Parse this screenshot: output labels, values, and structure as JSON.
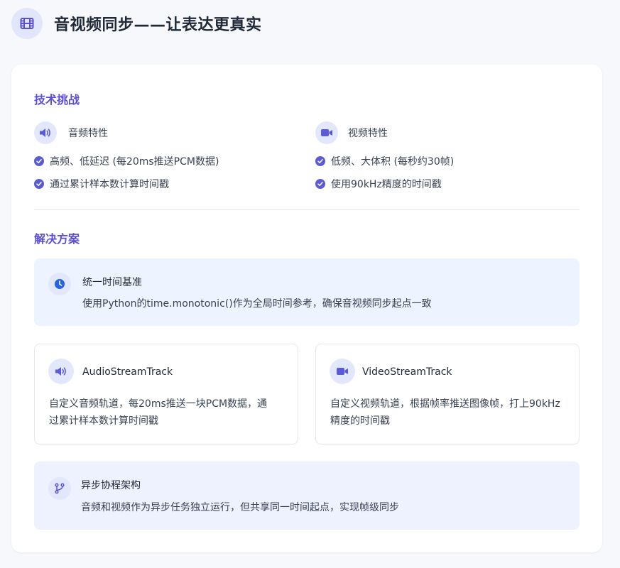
{
  "header": {
    "icon": "film-icon",
    "title": "音视频同步——让表达更真实"
  },
  "challenges": {
    "title": "技术挑战",
    "audio": {
      "icon": "speaker-icon",
      "title": "音频特性",
      "bullets": [
        "高频、低延迟 (每20ms推送PCM数据)",
        "通过累计样本数计算时间戳"
      ]
    },
    "video": {
      "icon": "video-camera-icon",
      "title": "视频特性",
      "bullets": [
        "低频、大体积 (每秒约30帧)",
        "使用90kHz精度的时间戳"
      ]
    }
  },
  "solutions": {
    "title": "解决方案",
    "unified": {
      "icon": "clock-icon",
      "title": "统一时间基准",
      "desc": "使用Python的time.monotonic()作为全局时间参考，确保音视频同步起点一致"
    },
    "audio_track": {
      "icon": "speaker-icon",
      "title": "AudioStreamTrack",
      "desc": "自定义音频轨道，每20ms推送一块PCM数据，通过累计样本数计算时间戳"
    },
    "video_track": {
      "icon": "video-camera-icon",
      "title": "VideoStreamTrack",
      "desc": "自定义视频轨道，根据帧率推送图像帧，打上90kHz精度的时间戳"
    },
    "async": {
      "icon": "branch-icon",
      "title": "异步协程架构",
      "desc": "音频和视频作为异步任务独立运行，但共享同一时间起点，实现帧级同步"
    }
  },
  "colors": {
    "accent": "#5b4fd6",
    "icon_bg": "#e3e7fb",
    "unified_bg": "#edf3ff",
    "async_bg": "#eef1fe",
    "clock_blue": "#2563eb"
  }
}
